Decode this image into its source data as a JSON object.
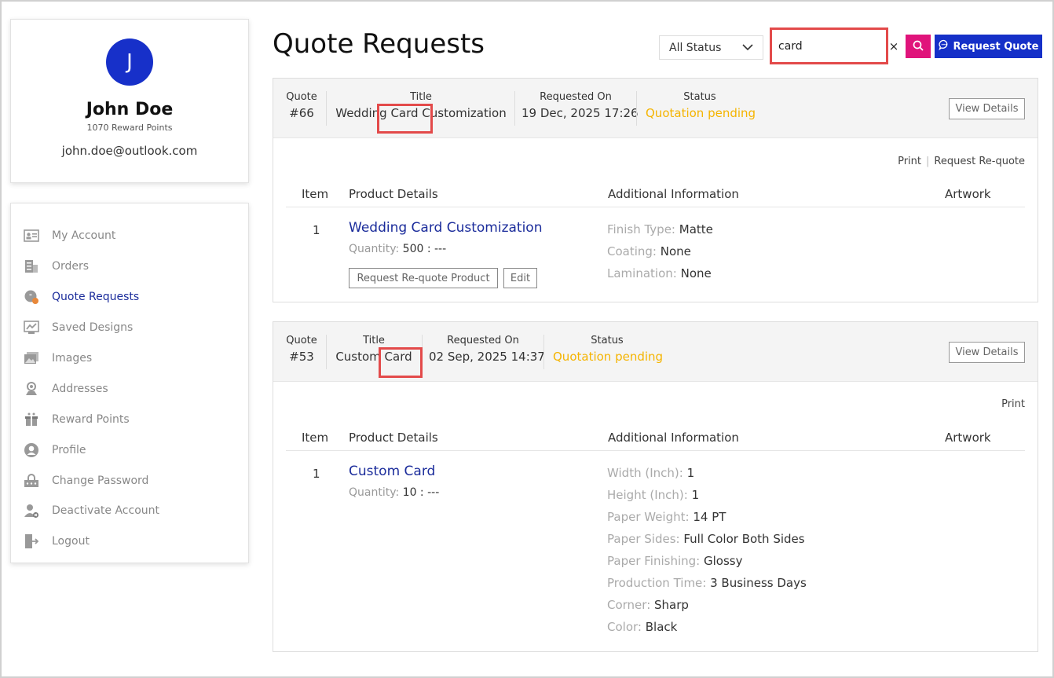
{
  "profile": {
    "initial": "J",
    "name": "John Doe",
    "reward_points": "1070 Reward Points",
    "email": "john.doe@outlook.com"
  },
  "menu": [
    {
      "label": "My Account",
      "icon": "account-card-icon"
    },
    {
      "label": "Orders",
      "icon": "orders-icon"
    },
    {
      "label": "Quote Requests",
      "icon": "quote-chat-icon"
    },
    {
      "label": "Saved Designs",
      "icon": "saved-designs-icon"
    },
    {
      "label": "Images",
      "icon": "images-icon"
    },
    {
      "label": "Addresses",
      "icon": "address-pin-icon"
    },
    {
      "label": "Reward Points",
      "icon": "gift-icon"
    },
    {
      "label": "Profile",
      "icon": "profile-icon"
    },
    {
      "label": "Change Password",
      "icon": "password-icon"
    },
    {
      "label": "Deactivate Account",
      "icon": "deactivate-user-icon"
    },
    {
      "label": "Logout",
      "icon": "logout-icon"
    }
  ],
  "active_menu": "Quote Requests",
  "header": {
    "title": "Quote Requests",
    "status_filter": "All Status",
    "search_value": "card",
    "clear_label": "×",
    "request_button": "Request Quote"
  },
  "colors": {
    "primary": "#1530c8",
    "accent": "#e0147b",
    "pending": "#f5b400",
    "highlight": "#e34a4a"
  },
  "labels": {
    "quote": "Quote",
    "title": "Title",
    "requested_on": "Requested On",
    "status": "Status",
    "view_details": "View Details",
    "print": "Print",
    "request_requote": "Request Re-quote",
    "col_item": "Item",
    "col_product": "Product Details",
    "col_additional": "Additional Information",
    "col_artwork": "Artwork",
    "quantity": "Quantity:",
    "request_requote_product": "Request Re-quote Product",
    "edit": "Edit"
  },
  "quotes": [
    {
      "number": "#66",
      "title": "Wedding Card Customization",
      "requested_on": "19 Dec, 2025 17:26",
      "status": "Quotation pending",
      "items": [
        {
          "no": "1",
          "name": "Wedding Card Customization",
          "quantity": "500 : ---",
          "attributes": [
            {
              "k": "Finish Type:",
              "v": "Matte"
            },
            {
              "k": "Coating:",
              "v": "None"
            },
            {
              "k": "Lamination:",
              "v": "None"
            }
          ]
        }
      ]
    },
    {
      "number": "#53",
      "title": "Custom Card",
      "requested_on": "02 Sep, 2025 14:37",
      "status": "Quotation pending",
      "items": [
        {
          "no": "1",
          "name": "Custom Card",
          "quantity": "10 : ---",
          "attributes": [
            {
              "k": "Width (Inch):",
              "v": "1"
            },
            {
              "k": "Height (Inch):",
              "v": "1"
            },
            {
              "k": "Paper Weight:",
              "v": "14 PT"
            },
            {
              "k": "Paper Sides:",
              "v": "Full Color Both Sides"
            },
            {
              "k": "Paper Finishing:",
              "v": "Glossy"
            },
            {
              "k": "Production Time:",
              "v": "3 Business Days"
            },
            {
              "k": "Corner:",
              "v": "Sharp"
            },
            {
              "k": "Color:",
              "v": "Black"
            }
          ]
        }
      ]
    }
  ]
}
